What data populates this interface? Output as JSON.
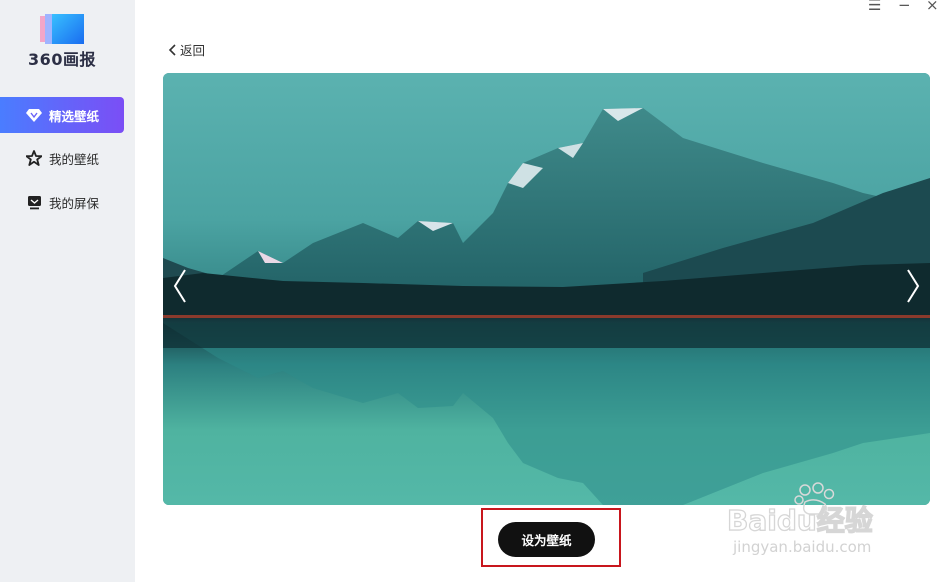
{
  "app": {
    "logo_text": "360画报"
  },
  "window_controls": {
    "menu": "☰",
    "minimize": "−",
    "close": "×"
  },
  "sidebar": {
    "items": [
      {
        "label": "精选壁纸",
        "icon": "diamond-icon",
        "active": true
      },
      {
        "label": "我的壁纸",
        "icon": "star-icon",
        "active": false
      },
      {
        "label": "我的屏保",
        "icon": "monitor-icon",
        "active": false
      }
    ]
  },
  "main": {
    "back_label": "返回",
    "preview": {
      "image": "mountain-lake-reflection"
    },
    "set_wallpaper_label": "设为壁纸"
  },
  "watermark": {
    "brand": "Baidu经验",
    "url": "jingyan.baidu.com"
  },
  "colors": {
    "accent_start": "#4a7dff",
    "accent_end": "#7b4ef5",
    "highlight_box": "#c8161d"
  }
}
